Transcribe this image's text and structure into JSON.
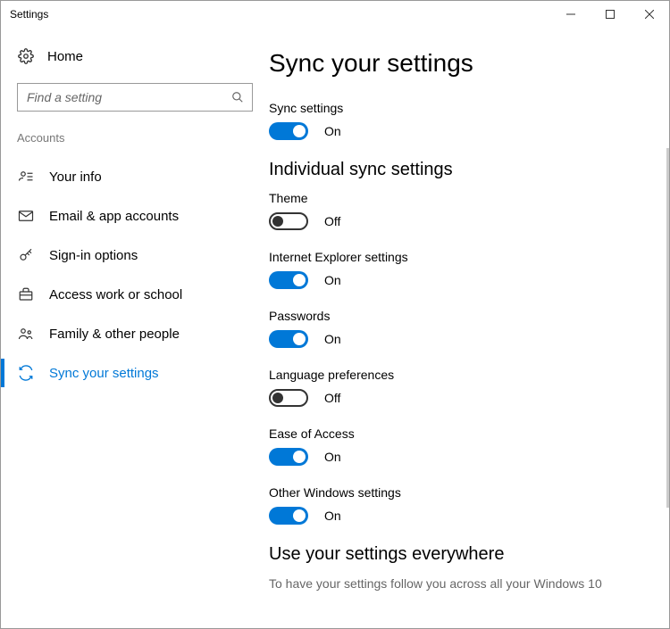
{
  "window": {
    "title": "Settings"
  },
  "sidebar": {
    "home": "Home",
    "search_placeholder": "Find a setting",
    "section": "Accounts",
    "items": [
      {
        "label": "Your info"
      },
      {
        "label": "Email & app accounts"
      },
      {
        "label": "Sign-in options"
      },
      {
        "label": "Access work or school"
      },
      {
        "label": "Family & other people"
      },
      {
        "label": "Sync your settings"
      }
    ]
  },
  "main": {
    "title": "Sync your settings",
    "sync_master": {
      "label": "Sync settings",
      "on": true,
      "state": "On"
    },
    "section_individual": "Individual sync settings",
    "toggles": [
      {
        "label": "Theme",
        "on": false,
        "state": "Off"
      },
      {
        "label": "Internet Explorer settings",
        "on": true,
        "state": "On"
      },
      {
        "label": "Passwords",
        "on": true,
        "state": "On"
      },
      {
        "label": "Language preferences",
        "on": false,
        "state": "Off"
      },
      {
        "label": "Ease of Access",
        "on": true,
        "state": "On"
      },
      {
        "label": "Other Windows settings",
        "on": true,
        "state": "On"
      }
    ],
    "footer_heading": "Use your settings everywhere",
    "footer_text": "To have your settings follow you across all your Windows 10"
  }
}
